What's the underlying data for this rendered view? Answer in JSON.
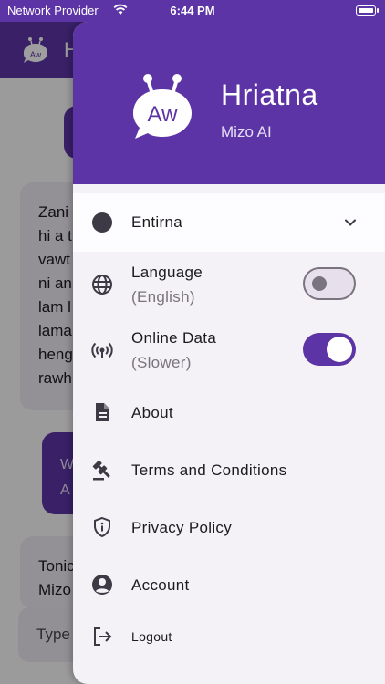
{
  "status_bar": {
    "carrier": "Network Provider",
    "time": "6:44 PM"
  },
  "background_app": {
    "title_partial": "H",
    "card_top_lines": [
      "Zani",
      "hi a t",
      "vawt",
      "ni an",
      "lam l",
      "lama",
      "heng",
      "rawh"
    ],
    "purple_bubble_lines": [
      "W",
      "A"
    ],
    "card_bottom_lines": [
      "Tonic",
      "Mizo"
    ],
    "input_placeholder_partial": "Type"
  },
  "drawer": {
    "header": {
      "logo_text": "Aw",
      "name": "Hriatna",
      "subtitle": "Mizo AI"
    },
    "selected_item": {
      "label": "Entirna"
    },
    "language": {
      "label": "Language",
      "sub": "(English)",
      "toggle_on": false
    },
    "online_data": {
      "label": "Online Data",
      "sub": "(Slower)",
      "toggle_on": true
    },
    "items": [
      {
        "label": "About",
        "icon": "document-icon"
      },
      {
        "label": "Terms and Conditions",
        "icon": "gavel-icon"
      },
      {
        "label": "Privacy Policy",
        "icon": "shield-info-icon"
      },
      {
        "label": "Account",
        "icon": "account-circle-icon"
      },
      {
        "label": "Logout",
        "icon": "logout-icon"
      }
    ]
  },
  "colors": {
    "primary": "#5c34a6",
    "drawer_bg": "#f4f1f7",
    "text": "#1c1b1f",
    "secondary_text": "#79747e"
  }
}
